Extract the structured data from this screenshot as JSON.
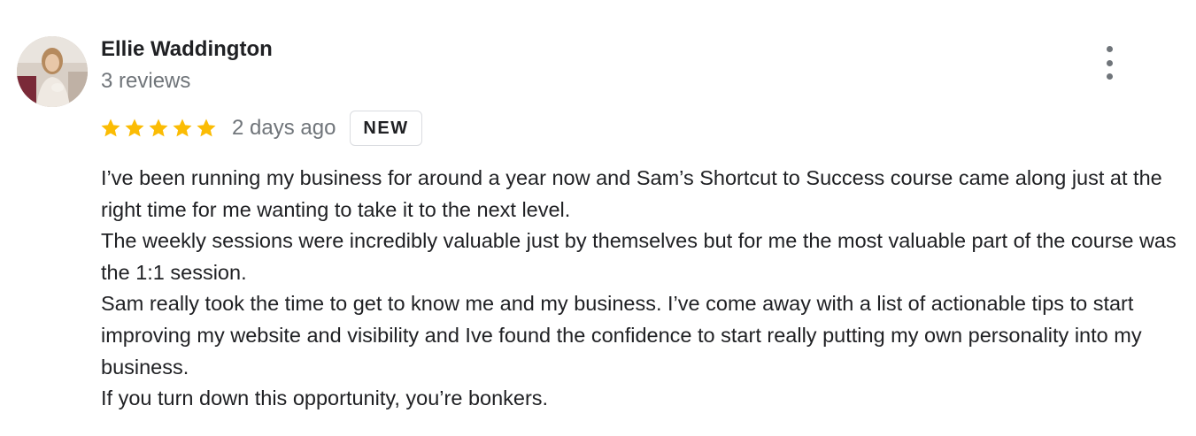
{
  "reviewer": {
    "name": "Ellie Waddington",
    "review_count": "3 reviews"
  },
  "review": {
    "rating": 5,
    "max_rating": 5,
    "date": "2 days ago",
    "badge": "NEW",
    "paragraphs": [
      "I’ve been running my business for around a year now and Sam’s Shortcut to Success course came along just at the right time for me wanting to take it to the next level.",
      "The weekly sessions were incredibly valuable just by themselves but for me the most valuable part of the course was the 1:1 session.",
      "Sam really took the time to get to know me and my business. I’ve come away with a list of actionable tips to start improving my website and visibility and Ive found the confidence to start really putting my own personality into my business.",
      "If you turn down this opportunity, you’re bonkers."
    ]
  },
  "icons": {
    "star": "star-icon",
    "more": "more-vert-icon"
  },
  "colors": {
    "star": "#fbbc04",
    "secondary_text": "#70757a",
    "primary_text": "#202124",
    "badge_border": "#dadce0"
  }
}
